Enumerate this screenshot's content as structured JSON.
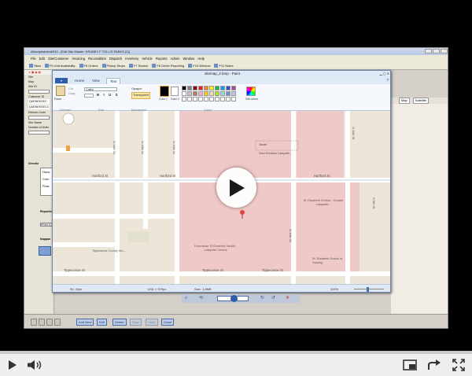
{
  "app": {
    "title": "Allscriptsdnlea0910 - [Edit Site Master: KRUBEY F TOLLIS PARKS (2)]",
    "menu": [
      "File",
      "Edit",
      "Site/Customer",
      "Invoicing",
      "Receivables",
      "Dispatch",
      "Inventory",
      "Vehicle",
      "Reports",
      "Admin",
      "Window",
      "Help"
    ],
    "toolbar": [
      "Sites",
      "F5 Unit Availability",
      "F6 Orders",
      "Pickup Stops",
      "F7 Search",
      "F8 Driver Reporting",
      "F10 Window",
      "F11 Notes"
    ],
    "left_labels": [
      "Site",
      "Map",
      "Site ID",
      "Customer ID",
      "Division Code",
      "Site Name",
      "Number of Units"
    ],
    "left_values": [
      "QUENEKSEC",
      "QUENEKSEC3"
    ],
    "left_sections": [
      "Directio",
      "Reporting",
      "Reporting",
      "Kappan"
    ],
    "left_list": [
      "Hous",
      "Com",
      "Flow"
    ],
    "left_inputs": [
      "PRESTON"
    ],
    "right_tabs": [
      "Map",
      "Satellite"
    ],
    "bottom_buttons": [
      "Add New",
      "Edit",
      "Delete",
      "Save",
      "Undo",
      "Close"
    ]
  },
  "paint": {
    "title": "sitemap_2.bmp - Paint",
    "tabs": [
      "Home",
      "View",
      "Text"
    ],
    "ribbon": {
      "font": "Calibri",
      "groups": [
        "Clipboard",
        "Font",
        "Background",
        "Colors"
      ],
      "paste_label": "Paste",
      "clipboard_items": [
        "Cut",
        "Copy"
      ],
      "opaque": [
        "Opaque",
        "Transparent"
      ],
      "color_labels": [
        "Color 1",
        "Color 2",
        "Edit colors"
      ],
      "font_style_buttons": [
        "B",
        "I",
        "U",
        "S"
      ],
      "swatches": [
        "#000000",
        "#7f7f7f",
        "#880015",
        "#ed1c24",
        "#ff7f27",
        "#fff200",
        "#22b14c",
        "#00a2e8",
        "#3f48cc",
        "#a349a4",
        "#ffffff",
        "#c3c3c3",
        "#b97a57",
        "#ffaec9",
        "#ffc90e",
        "#efe4b0",
        "#b5e61d",
        "#99d9ea",
        "#7092be",
        "#c8bfe7",
        "#ffffff",
        "#ffffff",
        "#ffffff",
        "#ffffff",
        "#ffffff",
        "#ffffff",
        "#ffffff",
        "#ffffff",
        "#ffffff",
        "#ffffff"
      ]
    },
    "map": {
      "streets": [
        "N 14th St",
        "N 13th St",
        "N 12th St",
        "N 11th St",
        "Hartford St",
        "Hartford St",
        "Hartford St",
        "Tippecanoe St",
        "Tippecanoe St",
        "Tippecanoe St",
        "N 10th St",
        "N 9th St"
      ],
      "places": [
        "Franciscan St Elizabeth Health - Lafayette Central",
        "Tippecanoe County Wo...",
        "St. Elizabeth Central - Greater Lafayette...",
        "St. Elizabeth School of Nursing",
        "Saint Boniface Lafayette...",
        "Jonet"
      ]
    },
    "status": {
      "position": "90, 42px",
      "selection": "1261 × 979px",
      "size": "Size: 1.8MB",
      "zoom": "100%",
      "zoom_level": 0.45
    }
  },
  "media_controls": [
    "zoom",
    "play",
    "stop",
    "next",
    "refresh",
    "close"
  ],
  "player": {
    "progress": 0.0,
    "accent": "#cc181e",
    "buttons": [
      "play-icon",
      "volume-icon",
      "fullscreen-small-icon",
      "share-icon",
      "fullscreen-icon"
    ]
  }
}
